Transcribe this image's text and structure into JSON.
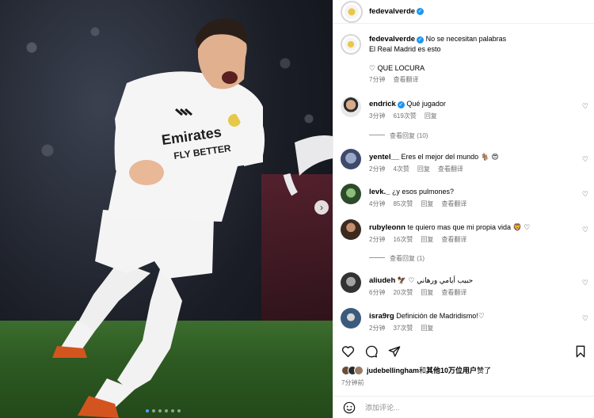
{
  "post": {
    "username": "fedevalverde",
    "caption_line1": "No se necesitan palabras",
    "caption_line2": "El Real Madrid es esto",
    "caption_line3": "♡ QUE LOCURA",
    "caption_time": "7分钟",
    "caption_translate": "查看翻译"
  },
  "comments": [
    {
      "user": "endrick",
      "verified": true,
      "text": "Qué jugador",
      "time": "3分钟",
      "likes": "619次赞",
      "reply": "回复",
      "translate": "",
      "view_replies": "查看回复 (10)"
    },
    {
      "user": "yentel__",
      "verified": false,
      "text": "Eres el mejor del mundo 🐐 😍",
      "time": "2分钟",
      "likes": "4次赞",
      "reply": "回复",
      "translate": "查看翻译",
      "view_replies": ""
    },
    {
      "user": "levk._",
      "verified": false,
      "text": "¿y esos pulmones?",
      "time": "4分钟",
      "likes": "85次赞",
      "reply": "回复",
      "translate": "查看翻译",
      "view_replies": ""
    },
    {
      "user": "rubyleonn",
      "verified": false,
      "text": "te quiero mas que mi propia vida 🦁 ♡",
      "time": "2分钟",
      "likes": "16次赞",
      "reply": "回复",
      "translate": "查看翻译",
      "view_replies": "查看回复 (1)"
    },
    {
      "user": "aliudeh",
      "verified": false,
      "text": "🦅 ♡ حبيب أيامي ورهاني",
      "time": "6分钟",
      "likes": "20次赞",
      "reply": "回复",
      "translate": "查看翻译",
      "view_replies": ""
    },
    {
      "user": "isra9rg",
      "verified": false,
      "text": "Definición de Madridismo!♡",
      "time": "2分钟",
      "likes": "37次赞",
      "reply": "回复",
      "translate": "",
      "view_replies": ""
    }
  ],
  "likes": {
    "liker": "judebellingham",
    "connector": "和",
    "others": "其他10万位用户",
    "suffix": "赞了"
  },
  "post_time": "7分钟前",
  "composer": {
    "placeholder": "添加评论..."
  },
  "icons": [
    "heart-icon",
    "comment-icon",
    "share-icon",
    "bookmark-icon",
    "emoji-icon",
    "chevron-right-icon",
    "verified-icon"
  ]
}
